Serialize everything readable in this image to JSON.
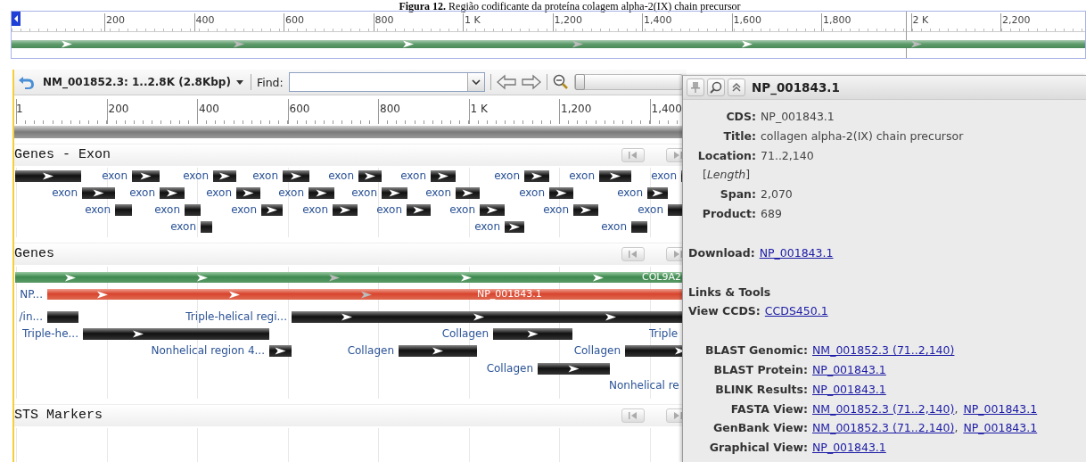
{
  "caption": "**Figura 12.** Região codificante da proteína colagem alpha-2(IX) chain precursor",
  "overview": {
    "ticks": [
      "200",
      "400",
      "600",
      "800",
      "1 K",
      "1,200",
      "1,400",
      "1,600",
      "1,800",
      "2 K",
      "2,200"
    ]
  },
  "toolbar": {
    "sequence": "NM_001852.3: 1..2.8K (2.8Kbp)",
    "find_label": "Find:",
    "zoom": {
      "level": 0
    }
  },
  "ruler": {
    "ticks": [
      "1",
      "200",
      "400",
      "600",
      "800",
      "1 K",
      "1,200",
      "1,400"
    ]
  },
  "tracks": [
    {
      "kind": "exon",
      "title": "Genes - Exon",
      "rows": [
        [
          {
            "kind": "feature"
          },
          {
            "kind": "feature",
            "label": "exon"
          },
          {
            "kind": "feature",
            "label": "exon"
          },
          {
            "kind": "feature",
            "label": "exon"
          },
          {
            "kind": "feature",
            "label": "exon"
          },
          {
            "kind": "feature",
            "label": "exon"
          },
          {
            "kind": "feature",
            "label": "exon"
          },
          {
            "kind": "feature",
            "label": "exon"
          },
          {
            "kind": "feature",
            "label": "exon"
          }
        ],
        [
          {
            "kind": "feature",
            "label": "exon"
          },
          {
            "kind": "feature",
            "label": "exon"
          },
          {
            "kind": "feature",
            "label": "exon"
          },
          {
            "kind": "feature",
            "label": "exon"
          },
          {
            "kind": "feature",
            "label": "exon"
          },
          {
            "kind": "feature",
            "label": "exon"
          },
          {
            "kind": "feature",
            "label": "exon"
          },
          {
            "kind": "feature",
            "label": "exon"
          }
        ],
        [
          {
            "kind": "plain",
            "label": "exon"
          },
          {
            "kind": "plain",
            "label": "exon"
          },
          {
            "kind": "feature",
            "label": "exon"
          },
          {
            "kind": "feature",
            "label": "exon"
          },
          {
            "kind": "feature",
            "label": "exon"
          },
          {
            "kind": "feature",
            "label": "exon"
          },
          {
            "kind": "feature",
            "label": "exon"
          },
          {
            "kind": "plain",
            "label": "exon"
          }
        ],
        [
          {
            "kind": "plain",
            "label": "exon"
          },
          {
            "kind": "feature",
            "label": "exon"
          },
          {
            "kind": "plain",
            "label": "exon"
          }
        ]
      ]
    },
    {
      "kind": "genes",
      "title": "Genes",
      "rows": [
        [
          {
            "kind": "gene",
            "bar_label": "COL9A2"
          }
        ],
        [
          {
            "kind": "cds",
            "label": "NP...",
            "bar_label": "NP_001843.1"
          }
        ],
        [
          {
            "kind": "plain",
            "label": "/in..."
          },
          {
            "kind": "feature",
            "label": "Triple-helical regi..."
          }
        ],
        [
          {
            "kind": "feature",
            "label": "Triple-he..."
          },
          {
            "kind": "feature",
            "label": "Collagen"
          },
          {
            "kind": "text",
            "label": "Triple"
          }
        ],
        [
          {
            "kind": "feature",
            "label": "Nonhelical region 4..."
          },
          {
            "kind": "feature",
            "label": "Collagen"
          },
          {
            "kind": "feature",
            "label": "Collagen"
          }
        ],
        [
          {
            "kind": "feature",
            "label": "Collagen"
          }
        ],
        [
          {
            "kind": "text",
            "label": "Nonhelical re"
          }
        ]
      ]
    },
    {
      "kind": "sts",
      "title": "STS Markers"
    }
  ],
  "popup": {
    "title": "NP_001843.1",
    "fields": [
      {
        "kind": "field",
        "label": "CDS:",
        "value": "NP_001843.1"
      },
      {
        "kind": "field",
        "label": "Title:",
        "value": "collagen alpha-2(IX) chain precursor"
      },
      {
        "kind": "field",
        "label": "Location:",
        "value": "71..2,140"
      },
      {
        "kind": "note",
        "text": "[*Length*]"
      },
      {
        "kind": "field",
        "label": "Span:",
        "value": "2,070"
      },
      {
        "kind": "field",
        "label": "Product:",
        "value": "689"
      }
    ],
    "download": {
      "label": "Download:",
      "link": "NP_001843.1"
    },
    "links_heading": "Links & Tools",
    "ccds": {
      "label": "View CCDS:",
      "link": "CCDS450.1"
    },
    "tools": [
      {
        "label": "BLAST Genomic:",
        "links": [
          {
            "text": "NM_001852.3 (71..2,140)"
          }
        ]
      },
      {
        "label": "BLAST Protein:",
        "links": [
          {
            "text": "NP_001843.1"
          }
        ]
      },
      {
        "label": "BLINK Results:",
        "links": [
          {
            "text": "NP_001843.1"
          }
        ]
      },
      {
        "label": "FASTA View:",
        "links": [
          {
            "text": "NM_001852.3 (71..2,140)",
            "suffix": ","
          },
          {
            "text": "NP_001843.1"
          }
        ]
      },
      {
        "label": "GenBank View:",
        "links": [
          {
            "text": "NM_001852.3 (71..2,140)",
            "suffix": ","
          },
          {
            "text": "NP_001843.1"
          }
        ]
      },
      {
        "label": "Graphical View:",
        "links": [
          {
            "text": "NP_001843.1"
          }
        ]
      }
    ]
  }
}
